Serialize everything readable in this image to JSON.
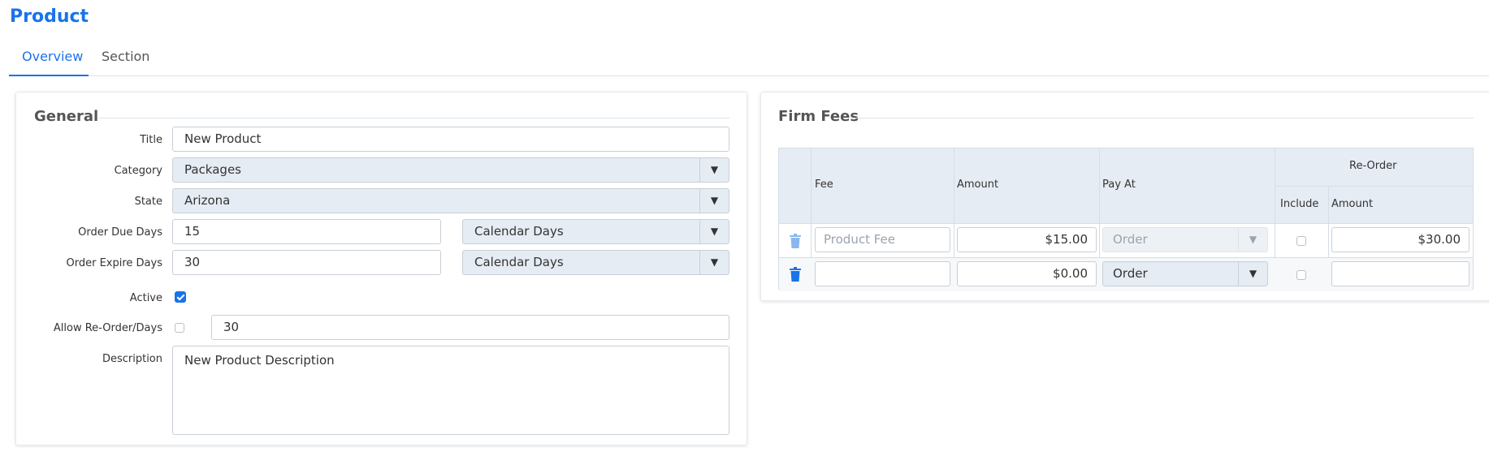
{
  "page": {
    "title": "Product"
  },
  "tabs": [
    {
      "label": "Overview",
      "active": true
    },
    {
      "label": "Section",
      "active": false
    }
  ],
  "general": {
    "legend": "General",
    "title_label": "Title",
    "title_value": "New Product",
    "category_label": "Category",
    "category_value": "Packages",
    "state_label": "State",
    "state_value": "Arizona",
    "due_label": "Order Due Days",
    "due_value": "15",
    "due_unit": "Calendar Days",
    "expire_label": "Order Expire Days",
    "expire_value": "30",
    "expire_unit": "Calendar Days",
    "active_label": "Active",
    "active_checked": true,
    "reorder_label": "Allow Re-Order/Days",
    "reorder_checked": false,
    "reorder_days": "30",
    "description_label": "Description",
    "description_value": "New Product Description"
  },
  "fees": {
    "legend": "Firm Fees",
    "headers": {
      "fee": "Fee",
      "amount": "Amount",
      "pay_at": "Pay At",
      "reorder": "Re-Order",
      "include": "Include",
      "reorder_amount": "Amount"
    },
    "rows": [
      {
        "fee": "",
        "fee_placeholder": "Product Fee",
        "amount": "$15.00",
        "pay_at": "Order",
        "include": false,
        "reorder_amount": "$30.00",
        "disabled": true
      },
      {
        "fee": "",
        "fee_placeholder": "",
        "amount": "$0.00",
        "pay_at": "Order",
        "include": false,
        "reorder_amount": "",
        "disabled": false
      }
    ]
  },
  "colors": {
    "accent": "#1a73e8",
    "trash": "#1a73e8",
    "trash_disabled": "#8ab8ee"
  },
  "icons": {
    "arrow": "▼",
    "trash": "trash-icon",
    "check": "check-icon"
  }
}
